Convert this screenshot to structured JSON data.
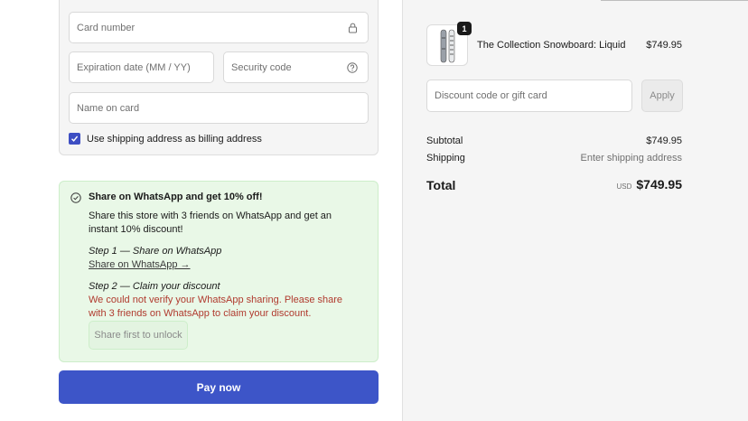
{
  "payment": {
    "card_number_placeholder": "Card number",
    "expiry_placeholder": "Expiration date (MM / YY)",
    "security_placeholder": "Security code",
    "name_placeholder": "Name on card",
    "billing_checkbox_label": "Use shipping address as billing address",
    "billing_checked": true
  },
  "share": {
    "title": "Share on WhatsApp and get 10% off!",
    "description": "Share this store with 3 friends on WhatsApp and get an instant 10% discount!",
    "step1_label": "Step 1 — Share on WhatsApp",
    "step1_link": "Share on WhatsApp →",
    "step2_label": "Step 2 — Claim your discount",
    "error_text": "We could not verify your WhatsApp sharing. Please share with 3 friends on WhatsApp to claim your discount.",
    "unlock_button": "Share first to unlock"
  },
  "pay_button": "Pay now",
  "summary": {
    "product": {
      "quantity": "1",
      "name": "The Collection Snowboard: Liquid",
      "price": "$749.95"
    },
    "discount_placeholder": "Discount code or gift card",
    "apply_button": "Apply",
    "subtotal_label": "Subtotal",
    "subtotal_value": "$749.95",
    "shipping_label": "Shipping",
    "shipping_value": "Enter shipping address",
    "total_label": "Total",
    "total_currency": "USD",
    "total_value": "$749.95"
  },
  "colors": {
    "accent": "#3d55c8",
    "error": "#b03a2e",
    "success_bg": "#e9f8e7"
  }
}
